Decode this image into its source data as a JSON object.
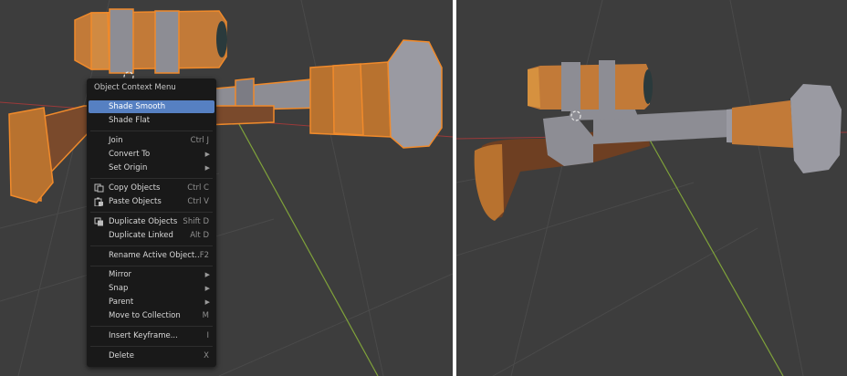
{
  "panels": [
    "left-viewport",
    "right-viewport"
  ],
  "context_menu": {
    "title": "Object Context Menu",
    "items": [
      {
        "label": "Shade Smooth",
        "shortcut": "",
        "submenu": false,
        "icon": "",
        "active": true
      },
      {
        "label": "Shade Flat",
        "shortcut": "",
        "submenu": false,
        "icon": ""
      },
      {
        "label": "Join",
        "shortcut": "Ctrl J",
        "submenu": false,
        "icon": ""
      },
      {
        "label": "Convert To",
        "shortcut": "",
        "submenu": true,
        "icon": ""
      },
      {
        "label": "Set Origin",
        "shortcut": "",
        "submenu": true,
        "icon": ""
      },
      {
        "label": "Copy Objects",
        "shortcut": "Ctrl C",
        "submenu": false,
        "icon": "copy-icon"
      },
      {
        "label": "Paste Objects",
        "shortcut": "Ctrl V",
        "submenu": false,
        "icon": "paste-icon"
      },
      {
        "label": "Duplicate Objects",
        "shortcut": "Shift D",
        "submenu": false,
        "icon": "duplicate-icon"
      },
      {
        "label": "Duplicate Linked",
        "shortcut": "Alt D",
        "submenu": false,
        "icon": ""
      },
      {
        "label": "Rename Active Object...",
        "shortcut": "F2",
        "submenu": false,
        "icon": ""
      },
      {
        "label": "Mirror",
        "shortcut": "",
        "submenu": true,
        "icon": ""
      },
      {
        "label": "Snap",
        "shortcut": "",
        "submenu": true,
        "icon": ""
      },
      {
        "label": "Parent",
        "shortcut": "",
        "submenu": true,
        "icon": ""
      },
      {
        "label": "Move to Collection",
        "shortcut": "M",
        "submenu": false,
        "icon": ""
      },
      {
        "label": "Insert Keyframe...",
        "shortcut": "I",
        "submenu": false,
        "icon": ""
      },
      {
        "label": "Delete",
        "shortcut": "X",
        "submenu": false,
        "icon": ""
      }
    ]
  },
  "colors": {
    "viewport_bg": "#3d3d3d",
    "menu_bg": "#191919",
    "highlight": "#5680c2",
    "selection_outline": "#f08a2b",
    "y_axis": "#7fa23a",
    "x_axis": "#9b3a3a",
    "wood": "#8a4e2a",
    "orange": "#c77c34",
    "metal": "#8d8d94"
  }
}
